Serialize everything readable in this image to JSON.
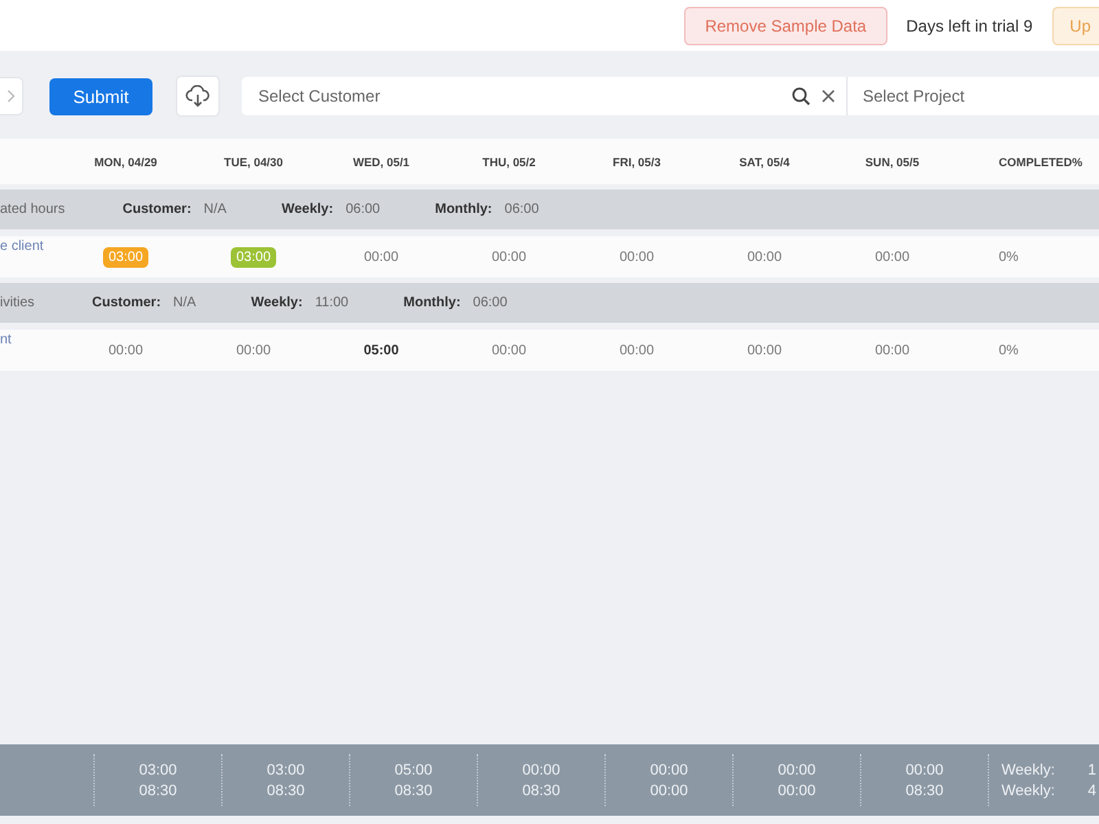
{
  "top_bar": {
    "remove_button": "Remove Sample Data",
    "trial_text": "Days left in trial 9",
    "upgrade_button": "Up"
  },
  "toolbar": {
    "submit_button": "Submit",
    "customer_placeholder": "Select Customer",
    "project_placeholder": "Select Project"
  },
  "table": {
    "columns": [
      "MON, 04/29",
      "TUE, 04/30",
      "WED, 05/1",
      "THU, 05/2",
      "FRI, 05/3",
      "SAT, 05/4",
      "SUN, 05/5",
      "COMPLETED%"
    ],
    "groups": [
      {
        "label": "ated hours",
        "customer_label": "Customer:",
        "customer": "N/A",
        "weekly_label": "Weekly:",
        "weekly": "06:00",
        "monthly_label": "Monthly:",
        "monthly": "06:00",
        "task": {
          "label": "e client",
          "cells": [
            {
              "kind": "badge",
              "text": "03:00",
              "color": "#f5a623"
            },
            {
              "kind": "badge",
              "text": "03:00",
              "color": "#9cc236"
            },
            {
              "kind": "plain",
              "text": "00:00"
            },
            {
              "kind": "plain",
              "text": "00:00"
            },
            {
              "kind": "plain",
              "text": "00:00"
            },
            {
              "kind": "plain",
              "text": "00:00"
            },
            {
              "kind": "plain",
              "text": "00:00"
            }
          ],
          "completed": "0%"
        }
      },
      {
        "label": "ivities",
        "customer_label": "Customer:",
        "customer": "N/A",
        "weekly_label": "Weekly:",
        "weekly": "11:00",
        "monthly_label": "Monthly:",
        "monthly": "06:00",
        "task": {
          "label": "nt",
          "cells": [
            {
              "kind": "plain",
              "text": "00:00"
            },
            {
              "kind": "plain",
              "text": "00:00"
            },
            {
              "kind": "bold",
              "text": "05:00"
            },
            {
              "kind": "plain",
              "text": "00:00"
            },
            {
              "kind": "plain",
              "text": "00:00"
            },
            {
              "kind": "plain",
              "text": "00:00"
            },
            {
              "kind": "plain",
              "text": "00:00"
            }
          ],
          "completed": "0%"
        }
      }
    ]
  },
  "footer": {
    "columns": [
      {
        "top": "03:00",
        "bottom": "08:30"
      },
      {
        "top": "03:00",
        "bottom": "08:30"
      },
      {
        "top": "05:00",
        "bottom": "08:30"
      },
      {
        "top": "00:00",
        "bottom": "08:30"
      },
      {
        "top": "00:00",
        "bottom": "00:00"
      },
      {
        "top": "00:00",
        "bottom": "00:00"
      },
      {
        "top": "00:00",
        "bottom": "08:30"
      }
    ],
    "weekly": [
      {
        "label": "Weekly:",
        "value": "1"
      },
      {
        "label": "Weekly:",
        "value": "4"
      }
    ]
  }
}
